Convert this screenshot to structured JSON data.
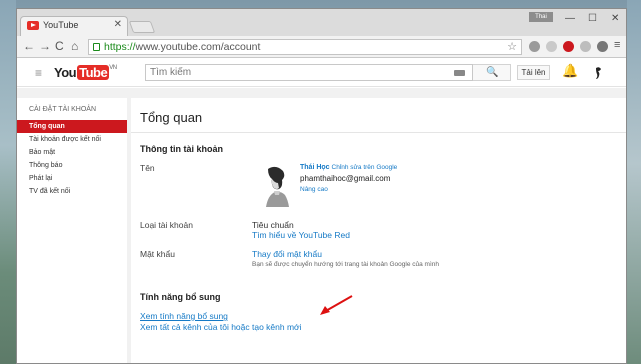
{
  "browser": {
    "tab_title": "YouTube",
    "tab_close": "✕",
    "profile": "Thai",
    "url_scheme": "https://",
    "url_host": "www.youtube.com",
    "url_path": "/account",
    "win_min": "—",
    "win_max": "☐",
    "win_close": "✕"
  },
  "youtube": {
    "logo_you": "You",
    "logo_tube": "Tube",
    "logo_region": "VN",
    "search_placeholder": "Tìm kiếm",
    "upload_label": "Tải lên"
  },
  "sidebar": {
    "heading": "CÀI ĐẶT TÀI KHOẢN",
    "items": [
      {
        "label": "Tổng quan"
      },
      {
        "label": "Tài khoản được kết nối"
      },
      {
        "label": "Bảo mật"
      },
      {
        "label": "Thông báo"
      },
      {
        "label": "Phát lại"
      },
      {
        "label": "TV đã kết nối"
      }
    ]
  },
  "main": {
    "title": "Tổng quan",
    "account_info_heading": "Thông tin tài khoản",
    "name_label": "Tên",
    "user_name": "Thái Học",
    "edit_google_link": "Chỉnh sửa trên Google",
    "email": "phamthaihoc@gmail.com",
    "upgrade_link": "Nâng cao",
    "account_type_label": "Loại tài khoản",
    "account_type_value": "Tiêu chuẩn",
    "red_link": "Tìm hiểu về YouTube Red",
    "password_label": "Mật khẩu",
    "change_password_link": "Thay đổi mật khẩu",
    "password_note": "Bạn sẽ được chuyển hướng tới trang tài khoản Google của mình",
    "extra_features_heading": "Tính năng bổ sung",
    "extra_features_link": "Xem tính năng bổ sung",
    "channels_link": "Xem tất cả kênh của tôi hoặc tạo kênh mới"
  },
  "colors": {
    "accent": "#cc181e",
    "link": "#167ac6"
  }
}
